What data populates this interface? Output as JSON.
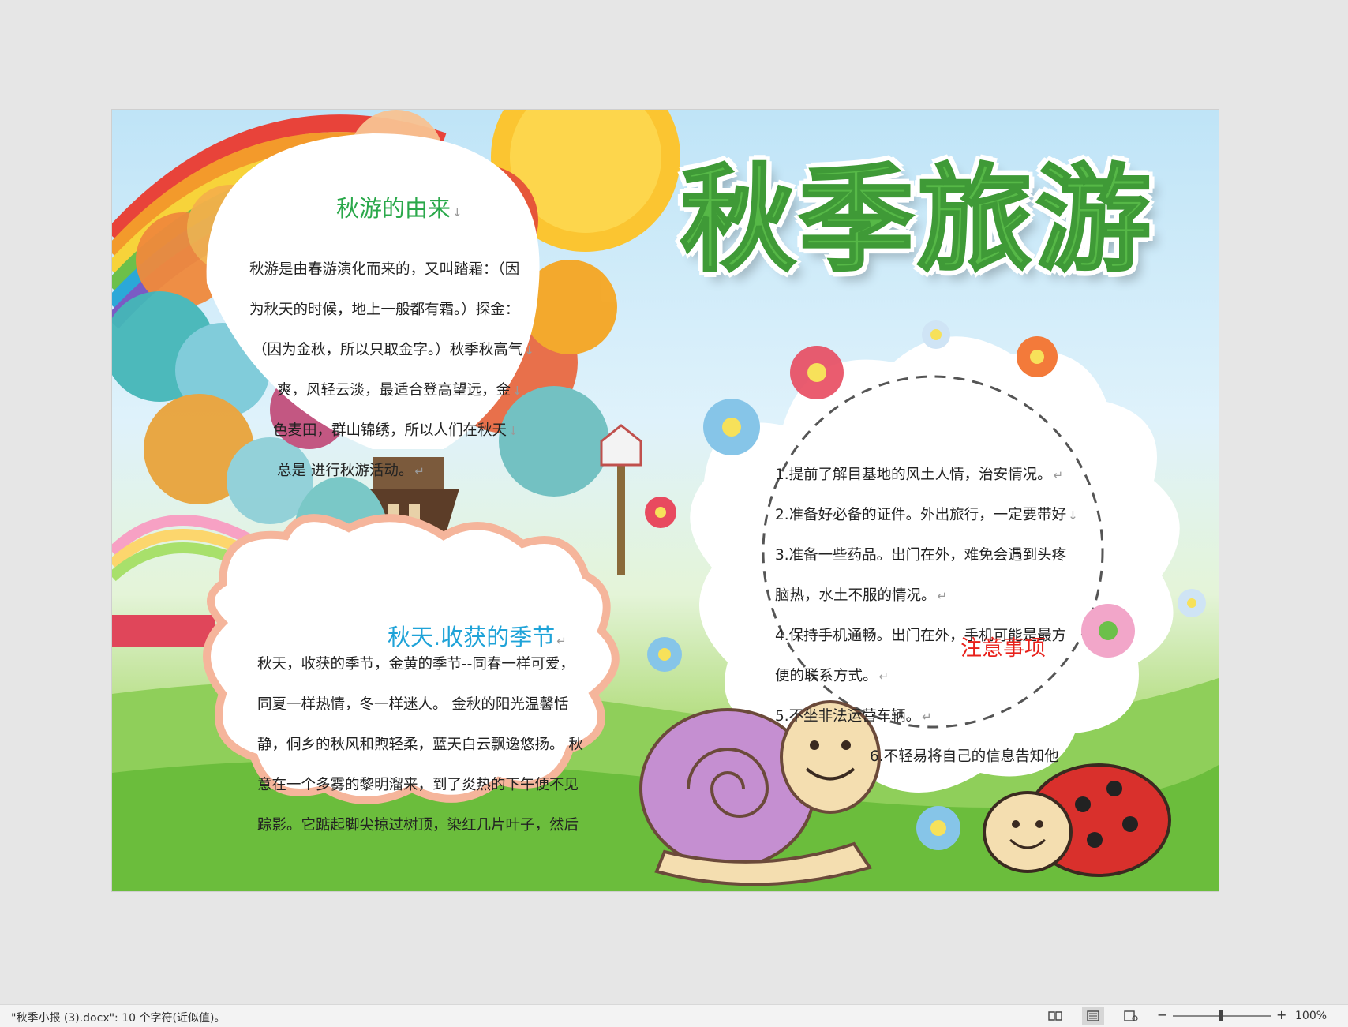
{
  "document": {
    "headline": "秋季旅游",
    "origin_section": {
      "title": "秋游的由来",
      "lines": [
        "秋游是由春游演化而来的，又叫踏霜：（因",
        "为秋天的时候，地上一般都有霜。）探金：",
        "（因为金秋，所以只取金字。）秋季秋高气",
        "爽，风轻云淡，最适合登高望远，金",
        "色麦田，群山锦绣，所以人们在秋天",
        "总是 进行秋游活动。"
      ]
    },
    "harvest_section": {
      "title": "秋天.收获的季节",
      "lines": [
        "秋天，收获的季节，金黄的季节--同春一样可爱，",
        "同夏一样热情，冬一样迷人。 金秋的阳光温馨恬",
        "静，侗乡的秋风和煦轻柔，蓝天白云飘逸悠扬。 秋",
        "意在一个多雾的黎明溜来，到了炎热的下午便不见",
        "踪影。它踮起脚尖掠过树顶，染红几片叶子，然后"
      ]
    },
    "notes_section": {
      "title": "注意事项",
      "items": [
        "1.提前了解目基地的风土人情，治安情况。",
        "2.准备好必备的证件。外出旅行，一定要带好",
        "3.准备一些药品。出门在外，难免会遇到头疼",
        "脑热，水土不服的情况。",
        "4.保持手机通畅。出门在外，手机可能是最方",
        "便的联系方式。",
        "5.不坐非法运营车辆。",
        "6.不轻易将自己的信息告知他"
      ]
    },
    "colors": {
      "headline": "#56b847",
      "origin_title": "#2aa84a",
      "harvest_title": "#1fa3d8",
      "notes_title": "#e8201a"
    },
    "marks": {
      "paragraph": "↵",
      "line_break": "↓"
    }
  },
  "status_bar": {
    "document_info": "\"秋季小报 (3).docx\": 10 个字符(近似值)。",
    "view_icons": [
      "read-mode-icon",
      "print-layout-icon",
      "web-layout-icon"
    ],
    "zoom_minus": "−",
    "zoom_plus": "+",
    "zoom_level": "100%",
    "zoom_fraction": 0.5
  }
}
